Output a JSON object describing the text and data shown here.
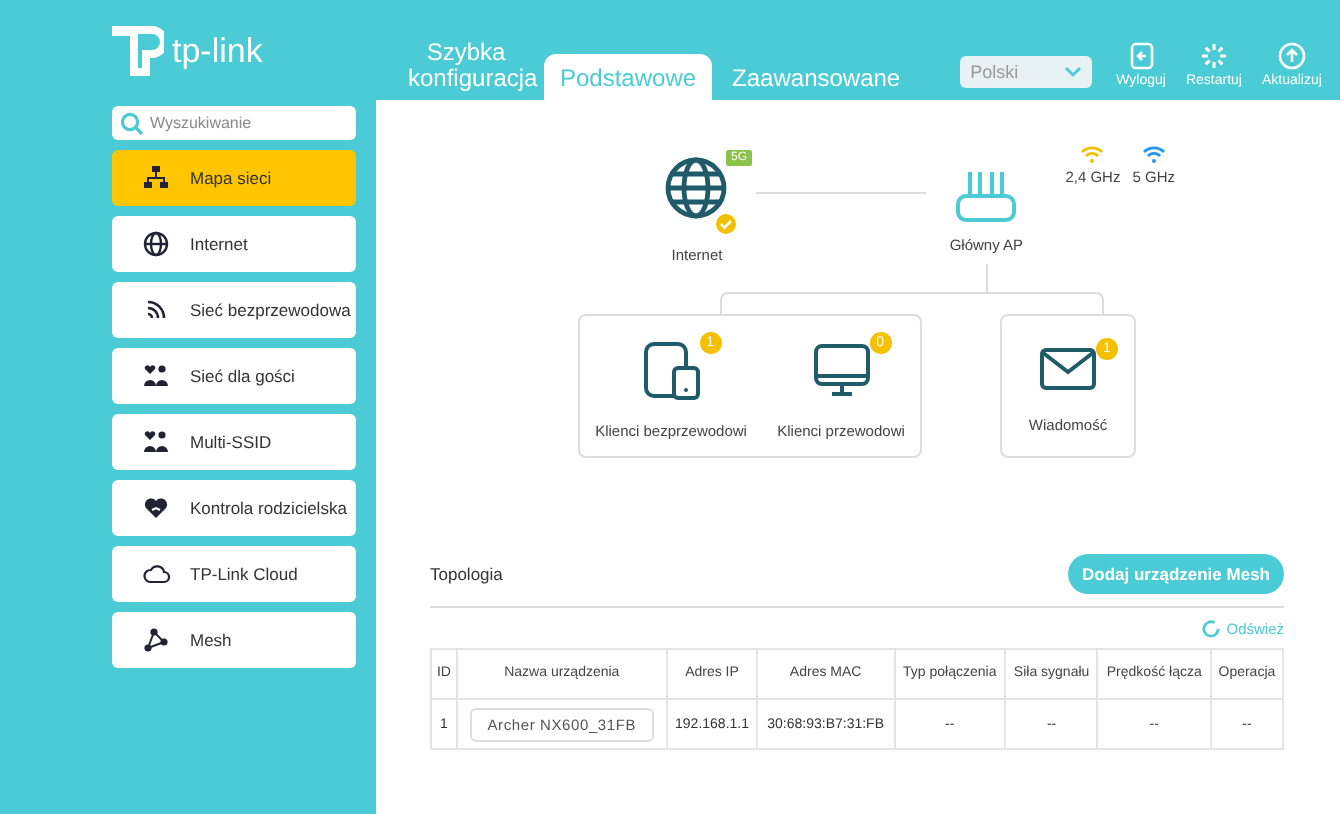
{
  "header": {
    "logo_text": "tp-link",
    "tabs": [
      {
        "label": "Szybka konfiguracja",
        "selected": false
      },
      {
        "label": "Podstawowe",
        "selected": true
      },
      {
        "label": "Zaawansowane",
        "selected": false
      }
    ],
    "language": "Polski",
    "actions": [
      {
        "kind": "logout",
        "label": "Wyloguj"
      },
      {
        "kind": "restart",
        "label": "Restartuj"
      },
      {
        "kind": "update",
        "label": "Aktualizuj"
      }
    ]
  },
  "sidebar": {
    "search": {
      "placeholder": "Wyszukiwanie"
    },
    "items": [
      {
        "kind": "map",
        "label": "Mapa sieci",
        "selected": true
      },
      {
        "kind": "globe",
        "label": "Internet",
        "selected": false
      },
      {
        "kind": "wireless",
        "label": "Sieć bezprzewodowa",
        "selected": false
      },
      {
        "kind": "guests",
        "label": "Sieć dla gości",
        "selected": false
      },
      {
        "kind": "guests",
        "label": "Multi-SSID",
        "selected": false
      },
      {
        "kind": "heart",
        "label": "Kontrola rodzicielska",
        "selected": false
      },
      {
        "kind": "cloud",
        "label": "TP-Link Cloud",
        "selected": false
      },
      {
        "kind": "mesh",
        "label": "Mesh",
        "selected": false
      }
    ]
  },
  "network_map": {
    "internet": {
      "label": "Internet",
      "badge": "5G"
    },
    "router": {
      "label": "Główny AP"
    },
    "bands": [
      "2,4 GHz",
      "5 GHz"
    ],
    "clients": [
      {
        "kind": "wireless",
        "label": "Klienci bezprzewodowi",
        "count": "1"
      },
      {
        "kind": "wired",
        "label": "Klienci przewodowi",
        "count": "0"
      }
    ],
    "message": {
      "label": "Wiadomość",
      "count": "1"
    }
  },
  "topology": {
    "title": "Topologia",
    "add_button": "Dodaj urządzenie Mesh",
    "refresh": "Odśwież",
    "columns": [
      "ID",
      "Nazwa urządzenia",
      "Adres IP",
      "Adres MAC",
      "Typ połączenia",
      "Siła sygnału",
      "Prędkość łącza",
      "Operacja"
    ],
    "rows": [
      [
        "1",
        "Archer NX600_31FB",
        "192.168.1.1",
        "30:68:93:B7:31:FB",
        "--",
        "--",
        "--",
        "--"
      ]
    ]
  }
}
